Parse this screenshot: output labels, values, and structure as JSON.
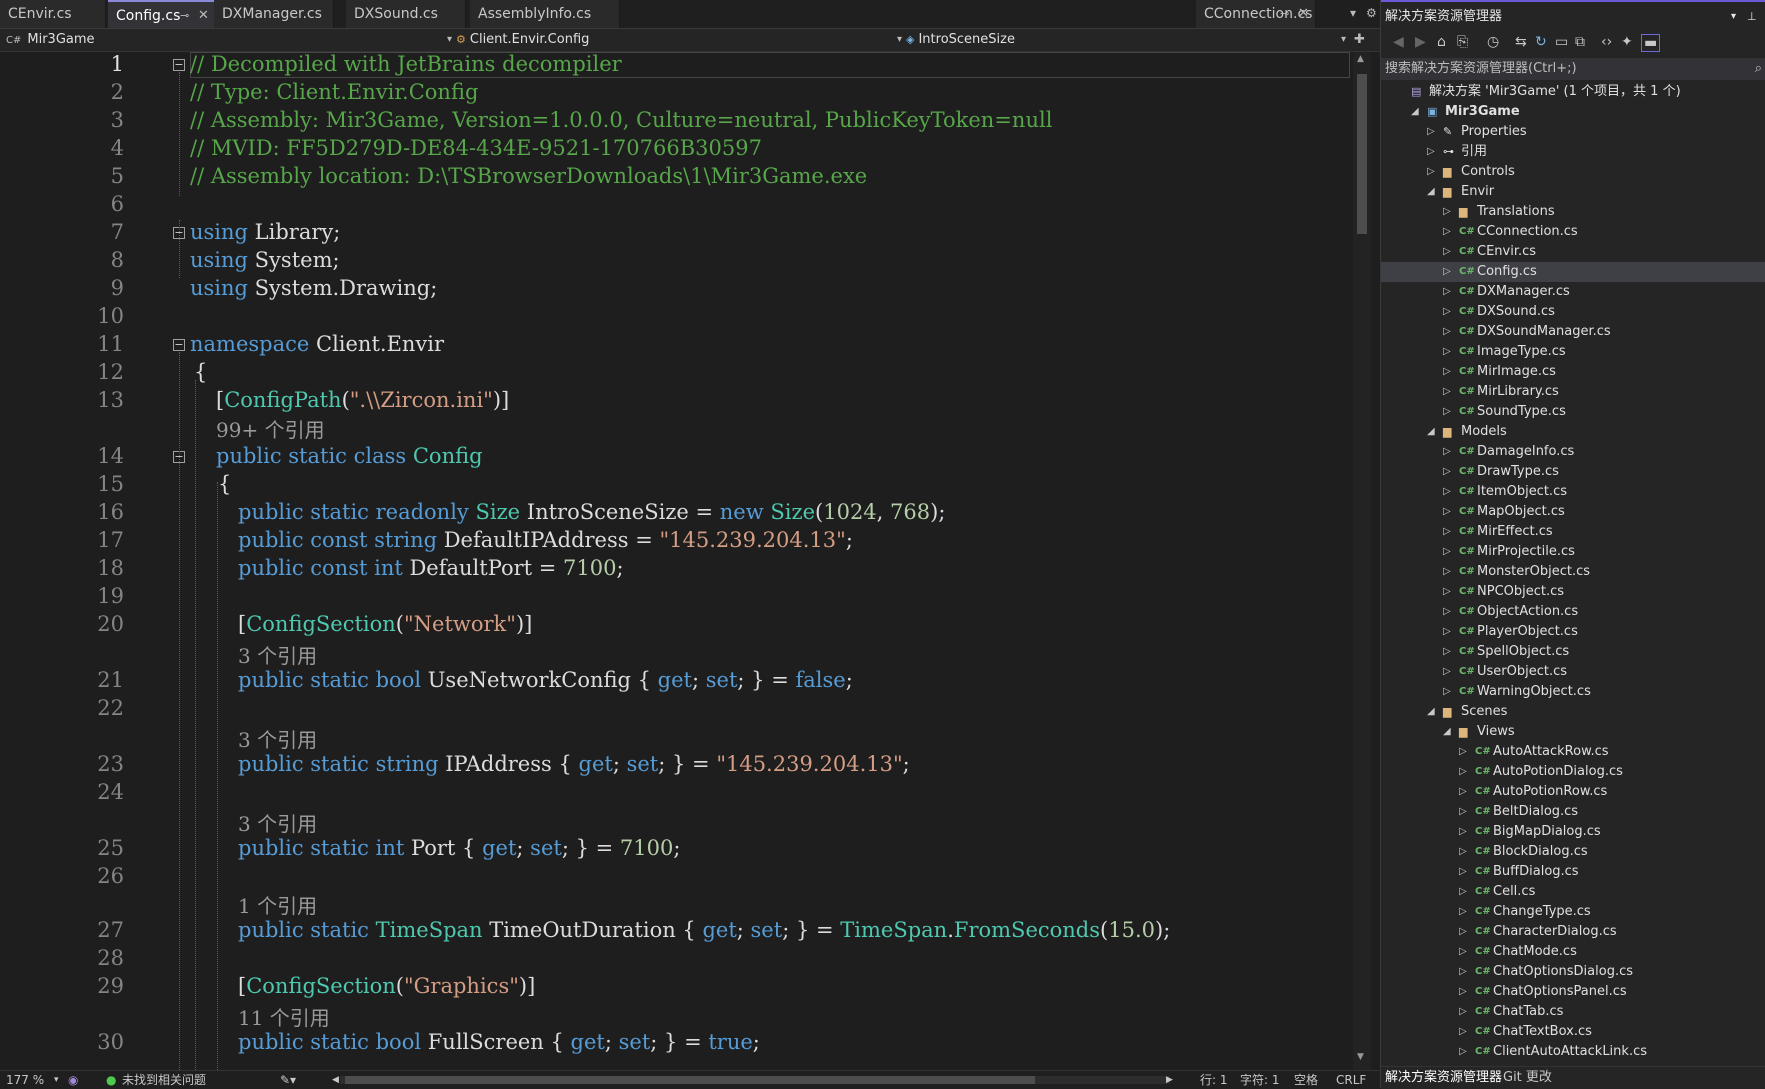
{
  "tabs": [
    {
      "label": "CEnvir.cs",
      "active": false
    },
    {
      "label": "Config.cs",
      "active": true
    },
    {
      "label": "DXManager.cs",
      "active": false
    },
    {
      "label": "DXSound.cs",
      "active": false
    },
    {
      "label": "AssemblyInfo.cs",
      "active": false
    },
    {
      "label": "CConnection.cs",
      "active": false
    }
  ],
  "nav": {
    "project": "Mir3Game",
    "type": "Client.Envir.Config",
    "member": "IntroSceneSize"
  },
  "lines": [
    {
      "n": "1",
      "tokens": [
        [
          "c-com",
          "// Decompiled with JetBrains decompiler"
        ]
      ]
    },
    {
      "n": "2",
      "tokens": [
        [
          "c-com",
          "// Type: Client.Envir.Config"
        ]
      ]
    },
    {
      "n": "3",
      "tokens": [
        [
          "c-com",
          "// Assembly: Mir3Game, Version=1.0.0.0, Culture=neutral, PublicKeyToken=null"
        ]
      ]
    },
    {
      "n": "4",
      "tokens": [
        [
          "c-com",
          "// MVID: FF5D279D-DE84-434E-9521-170766B30597"
        ]
      ]
    },
    {
      "n": "5",
      "tokens": [
        [
          "c-com",
          "// Assembly location: D:\\TSBrowserDownloads\\1\\Mir3Game.exe"
        ]
      ]
    },
    {
      "n": "6",
      "tokens": []
    },
    {
      "n": "7",
      "tokens": [
        [
          "c-kw",
          "using"
        ],
        [
          "c-id",
          " Library;"
        ]
      ]
    },
    {
      "n": "8",
      "tokens": [
        [
          "c-kw",
          "using"
        ],
        [
          "c-id",
          " System;"
        ]
      ]
    },
    {
      "n": "9",
      "tokens": [
        [
          "c-kw",
          "using"
        ],
        [
          "c-id",
          " System.Drawing;"
        ]
      ]
    },
    {
      "n": "10",
      "tokens": []
    },
    {
      "n": "11",
      "tokens": [
        [
          "c-kw",
          "namespace"
        ],
        [
          "c-id",
          " Client.Envir"
        ]
      ]
    },
    {
      "n": "12",
      "tokens": [
        [
          "c-pun",
          "{"
        ]
      ]
    },
    {
      "n": "13",
      "tokens": [
        [
          "c-pun",
          "["
        ],
        [
          "c-type",
          "ConfigPath"
        ],
        [
          "c-pun",
          "("
        ],
        [
          "c-str",
          "\".\\\\Zircon.ini\""
        ],
        [
          "c-pun",
          ")]"
        ]
      ]
    },
    {
      "n": "14",
      "tokens": [
        [
          "c-kw",
          "public static class"
        ],
        [
          "c-id",
          " "
        ],
        [
          "c-type",
          "Config"
        ]
      ]
    },
    {
      "n": "15",
      "tokens": [
        [
          "c-pun",
          "{"
        ]
      ]
    },
    {
      "n": "16",
      "tokens": [
        [
          "c-kw",
          "public static readonly"
        ],
        [
          "c-id",
          " "
        ],
        [
          "c-type",
          "Size"
        ],
        [
          "c-id",
          " IntroSceneSize = "
        ],
        [
          "c-kw",
          "new"
        ],
        [
          "c-id",
          " "
        ],
        [
          "c-type",
          "Size"
        ],
        [
          "c-pun",
          "("
        ],
        [
          "c-num",
          "1024"
        ],
        [
          "c-pun",
          ", "
        ],
        [
          "c-num",
          "768"
        ],
        [
          "c-pun",
          ");"
        ]
      ]
    },
    {
      "n": "17",
      "tokens": [
        [
          "c-kw",
          "public const string"
        ],
        [
          "c-id",
          " DefaultIPAddress = "
        ],
        [
          "c-str",
          "\"145.239.204.13\""
        ],
        [
          "c-pun",
          ";"
        ]
      ]
    },
    {
      "n": "18",
      "tokens": [
        [
          "c-kw",
          "public const int"
        ],
        [
          "c-id",
          " DefaultPort = "
        ],
        [
          "c-num",
          "7100"
        ],
        [
          "c-pun",
          ";"
        ]
      ]
    },
    {
      "n": "19",
      "tokens": []
    },
    {
      "n": "20",
      "tokens": [
        [
          "c-pun",
          "["
        ],
        [
          "c-type",
          "ConfigSection"
        ],
        [
          "c-pun",
          "("
        ],
        [
          "c-str",
          "\"Network\""
        ],
        [
          "c-pun",
          ")]"
        ]
      ]
    },
    {
      "n": "21",
      "tokens": [
        [
          "c-kw",
          "public static bool"
        ],
        [
          "c-id",
          " UseNetworkConfig { "
        ],
        [
          "c-kw",
          "get"
        ],
        [
          "c-pun",
          "; "
        ],
        [
          "c-kw",
          "set"
        ],
        [
          "c-pun",
          "; } = "
        ],
        [
          "c-kw",
          "false"
        ],
        [
          "c-pun",
          ";"
        ]
      ]
    },
    {
      "n": "22",
      "tokens": []
    },
    {
      "n": "23",
      "tokens": [
        [
          "c-kw",
          "public static string"
        ],
        [
          "c-id",
          " IPAddress { "
        ],
        [
          "c-kw",
          "get"
        ],
        [
          "c-pun",
          "; "
        ],
        [
          "c-kw",
          "set"
        ],
        [
          "c-pun",
          "; } = "
        ],
        [
          "c-str",
          "\"145.239.204.13\""
        ],
        [
          "c-pun",
          ";"
        ]
      ]
    },
    {
      "n": "24",
      "tokens": []
    },
    {
      "n": "25",
      "tokens": [
        [
          "c-kw",
          "public static int"
        ],
        [
          "c-id",
          " Port { "
        ],
        [
          "c-kw",
          "get"
        ],
        [
          "c-pun",
          "; "
        ],
        [
          "c-kw",
          "set"
        ],
        [
          "c-pun",
          "; } = "
        ],
        [
          "c-num",
          "7100"
        ],
        [
          "c-pun",
          ";"
        ]
      ]
    },
    {
      "n": "26",
      "tokens": []
    },
    {
      "n": "27",
      "tokens": [
        [
          "c-kw",
          "public static"
        ],
        [
          "c-id",
          " "
        ],
        [
          "c-type",
          "TimeSpan"
        ],
        [
          "c-id",
          " TimeOutDuration { "
        ],
        [
          "c-kw",
          "get"
        ],
        [
          "c-pun",
          "; "
        ],
        [
          "c-kw",
          "set"
        ],
        [
          "c-pun",
          "; } = "
        ],
        [
          "c-type",
          "TimeSpan"
        ],
        [
          "c-id",
          "."
        ],
        [
          "c-type",
          "FromSeconds"
        ],
        [
          "c-pun",
          "("
        ],
        [
          "c-num",
          "15.0"
        ],
        [
          "c-pun",
          ");"
        ]
      ]
    },
    {
      "n": "28",
      "tokens": []
    },
    {
      "n": "29",
      "tokens": [
        [
          "c-pun",
          "["
        ],
        [
          "c-type",
          "ConfigSection"
        ],
        [
          "c-pun",
          "("
        ],
        [
          "c-str",
          "\"Graphics\""
        ],
        [
          "c-pun",
          ")]"
        ]
      ]
    },
    {
      "n": "30",
      "tokens": [
        [
          "c-kw",
          "public static bool"
        ],
        [
          "c-id",
          " FullScreen { "
        ],
        [
          "c-kw",
          "get"
        ],
        [
          "c-pun",
          "; "
        ],
        [
          "c-kw",
          "set"
        ],
        [
          "c-pun",
          "; } = "
        ],
        [
          "c-kw",
          "true"
        ],
        [
          "c-pun",
          ";"
        ]
      ]
    }
  ],
  "refs": {
    "r14": "99+ 个引用",
    "r21": "3 个引用",
    "r23": "3 个引用",
    "r25": "3 个引用",
    "r27": "1 个引用",
    "r30": "11 个引用"
  },
  "status": {
    "zoom": "177 %",
    "issues": "未找到相关问题",
    "line": "行: 1",
    "char": "字符: 1",
    "spaces": "空格",
    "eol": "CRLF"
  },
  "solution_explorer": {
    "title": "解决方案资源管理器",
    "search_placeholder": "搜索解决方案资源管理器(Ctrl+;)",
    "tree": [
      {
        "label": "解决方案 'Mir3Game' (1 个项目，共 1 个)",
        "depth": 0,
        "icon": "sln",
        "arrow": ""
      },
      {
        "label": "Mir3Game",
        "depth": 1,
        "icon": "proj",
        "arrow": "open",
        "bold": true
      },
      {
        "label": "Properties",
        "depth": 2,
        "icon": "wrench",
        "arrow": "closed"
      },
      {
        "label": "引用",
        "depth": 2,
        "icon": "ref",
        "arrow": "closed"
      },
      {
        "label": "Controls",
        "depth": 2,
        "icon": "folder",
        "arrow": "closed"
      },
      {
        "label": "Envir",
        "depth": 2,
        "icon": "folder",
        "arrow": "open"
      },
      {
        "label": "Translations",
        "depth": 3,
        "icon": "folder",
        "arrow": "closed"
      },
      {
        "label": "CConnection.cs",
        "depth": 3,
        "icon": "cs",
        "arrow": "closed"
      },
      {
        "label": "CEnvir.cs",
        "depth": 3,
        "icon": "cs",
        "arrow": "closed"
      },
      {
        "label": "Config.cs",
        "depth": 3,
        "icon": "cs",
        "arrow": "closed",
        "selected": true
      },
      {
        "label": "DXManager.cs",
        "depth": 3,
        "icon": "cs",
        "arrow": "closed"
      },
      {
        "label": "DXSound.cs",
        "depth": 3,
        "icon": "cs",
        "arrow": "closed"
      },
      {
        "label": "DXSoundManager.cs",
        "depth": 3,
        "icon": "cs",
        "arrow": "closed"
      },
      {
        "label": "ImageType.cs",
        "depth": 3,
        "icon": "cs",
        "arrow": "closed"
      },
      {
        "label": "MirImage.cs",
        "depth": 3,
        "icon": "cs",
        "arrow": "closed"
      },
      {
        "label": "MirLibrary.cs",
        "depth": 3,
        "icon": "cs",
        "arrow": "closed"
      },
      {
        "label": "SoundType.cs",
        "depth": 3,
        "icon": "cs",
        "arrow": "closed"
      },
      {
        "label": "Models",
        "depth": 2,
        "icon": "folder",
        "arrow": "open"
      },
      {
        "label": "DamageInfo.cs",
        "depth": 3,
        "icon": "cs",
        "arrow": "closed"
      },
      {
        "label": "DrawType.cs",
        "depth": 3,
        "icon": "cs",
        "arrow": "closed"
      },
      {
        "label": "ItemObject.cs",
        "depth": 3,
        "icon": "cs",
        "arrow": "closed"
      },
      {
        "label": "MapObject.cs",
        "depth": 3,
        "icon": "cs",
        "arrow": "closed"
      },
      {
        "label": "MirEffect.cs",
        "depth": 3,
        "icon": "cs",
        "arrow": "closed"
      },
      {
        "label": "MirProjectile.cs",
        "depth": 3,
        "icon": "cs",
        "arrow": "closed"
      },
      {
        "label": "MonsterObject.cs",
        "depth": 3,
        "icon": "cs",
        "arrow": "closed"
      },
      {
        "label": "NPCObject.cs",
        "depth": 3,
        "icon": "cs",
        "arrow": "closed"
      },
      {
        "label": "ObjectAction.cs",
        "depth": 3,
        "icon": "cs",
        "arrow": "closed"
      },
      {
        "label": "PlayerObject.cs",
        "depth": 3,
        "icon": "cs",
        "arrow": "closed"
      },
      {
        "label": "SpellObject.cs",
        "depth": 3,
        "icon": "cs",
        "arrow": "closed"
      },
      {
        "label": "UserObject.cs",
        "depth": 3,
        "icon": "cs",
        "arrow": "closed"
      },
      {
        "label": "WarningObject.cs",
        "depth": 3,
        "icon": "cs",
        "arrow": "closed"
      },
      {
        "label": "Scenes",
        "depth": 2,
        "icon": "folder",
        "arrow": "open"
      },
      {
        "label": "Views",
        "depth": 3,
        "icon": "folder",
        "arrow": "open"
      },
      {
        "label": "AutoAttackRow.cs",
        "depth": 4,
        "icon": "cs",
        "arrow": "closed"
      },
      {
        "label": "AutoPotionDialog.cs",
        "depth": 4,
        "icon": "cs",
        "arrow": "closed"
      },
      {
        "label": "AutoPotionRow.cs",
        "depth": 4,
        "icon": "cs",
        "arrow": "closed"
      },
      {
        "label": "BeltDialog.cs",
        "depth": 4,
        "icon": "cs",
        "arrow": "closed"
      },
      {
        "label": "BigMapDialog.cs",
        "depth": 4,
        "icon": "cs",
        "arrow": "closed"
      },
      {
        "label": "BlockDialog.cs",
        "depth": 4,
        "icon": "cs",
        "arrow": "closed"
      },
      {
        "label": "BuffDialog.cs",
        "depth": 4,
        "icon": "cs",
        "arrow": "closed"
      },
      {
        "label": "Cell.cs",
        "depth": 4,
        "icon": "cs",
        "arrow": "closed"
      },
      {
        "label": "ChangeType.cs",
        "depth": 4,
        "icon": "cs",
        "arrow": "closed"
      },
      {
        "label": "CharacterDialog.cs",
        "depth": 4,
        "icon": "cs",
        "arrow": "closed"
      },
      {
        "label": "ChatMode.cs",
        "depth": 4,
        "icon": "cs",
        "arrow": "closed"
      },
      {
        "label": "ChatOptionsDialog.cs",
        "depth": 4,
        "icon": "cs",
        "arrow": "closed"
      },
      {
        "label": "ChatOptionsPanel.cs",
        "depth": 4,
        "icon": "cs",
        "arrow": "closed"
      },
      {
        "label": "ChatTab.cs",
        "depth": 4,
        "icon": "cs",
        "arrow": "closed"
      },
      {
        "label": "ChatTextBox.cs",
        "depth": 4,
        "icon": "cs",
        "arrow": "closed"
      },
      {
        "label": "ClientAutoAttackLink.cs",
        "depth": 4,
        "icon": "cs",
        "arrow": "closed"
      }
    ],
    "bottom_tabs": [
      "解决方案资源管理器",
      "Git 更改"
    ]
  }
}
